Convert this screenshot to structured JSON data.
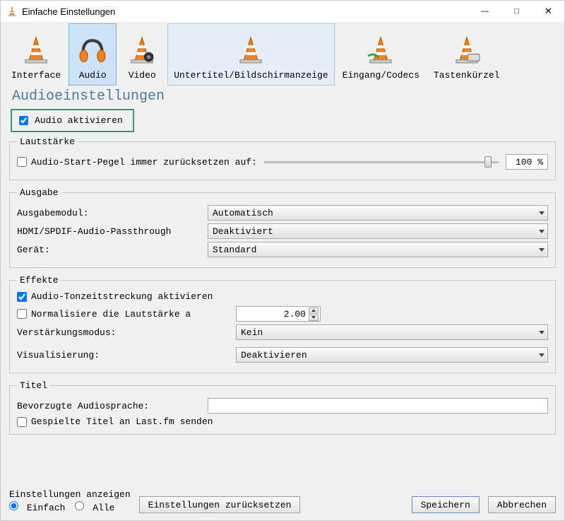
{
  "window": {
    "title": "Einfache Einstellungen"
  },
  "tabs": [
    {
      "label": "Interface"
    },
    {
      "label": "Audio"
    },
    {
      "label": "Video"
    },
    {
      "label": "Untertitel/Bildschirmanzeige"
    },
    {
      "label": "Eingang/Codecs"
    },
    {
      "label": "Tastenkürzel"
    }
  ],
  "page_title": "Audioeinstellungen",
  "enable_audio": {
    "label": "Audio aktivieren",
    "checked": true
  },
  "volume": {
    "legend": "Lautstärke",
    "reset_label": "Audio-Start-Pegel immer zurücksetzen auf:",
    "reset_checked": false,
    "percent": "100 %"
  },
  "output": {
    "legend": "Ausgabe",
    "module_label": "Ausgabemodul:",
    "module_value": "Automatisch",
    "hdmi_label": "HDMI/SPDIF-Audio-Passthrough",
    "hdmi_value": "Deaktiviert",
    "device_label": "Gerät:",
    "device_value": "Standard"
  },
  "effects": {
    "legend": "Effekte",
    "timestretch_label": "Audio-Tonzeitstreckung aktivieren",
    "timestretch_checked": true,
    "normalize_label": "Normalisiere die Lautstärke a",
    "normalize_checked": false,
    "normalize_value": "2.00",
    "gain_label": "Verstärkungsmodus:",
    "gain_value": "Kein",
    "visual_label": "Visualisierung:",
    "visual_value": "Deaktivieren"
  },
  "titles": {
    "legend": "Titel",
    "lang_label": "Bevorzugte Audiosprache:",
    "lang_value": "",
    "lastfm_label": "Gespielte Titel an Last.fm senden",
    "lastfm_checked": false
  },
  "show_settings": {
    "legend": "Einstellungen anzeigen",
    "simple": "Einfach",
    "all": "Alle",
    "selected": "simple"
  },
  "buttons": {
    "reset": "Einstellungen zurücksetzen",
    "save": "Speichern",
    "cancel": "Abbrechen"
  }
}
